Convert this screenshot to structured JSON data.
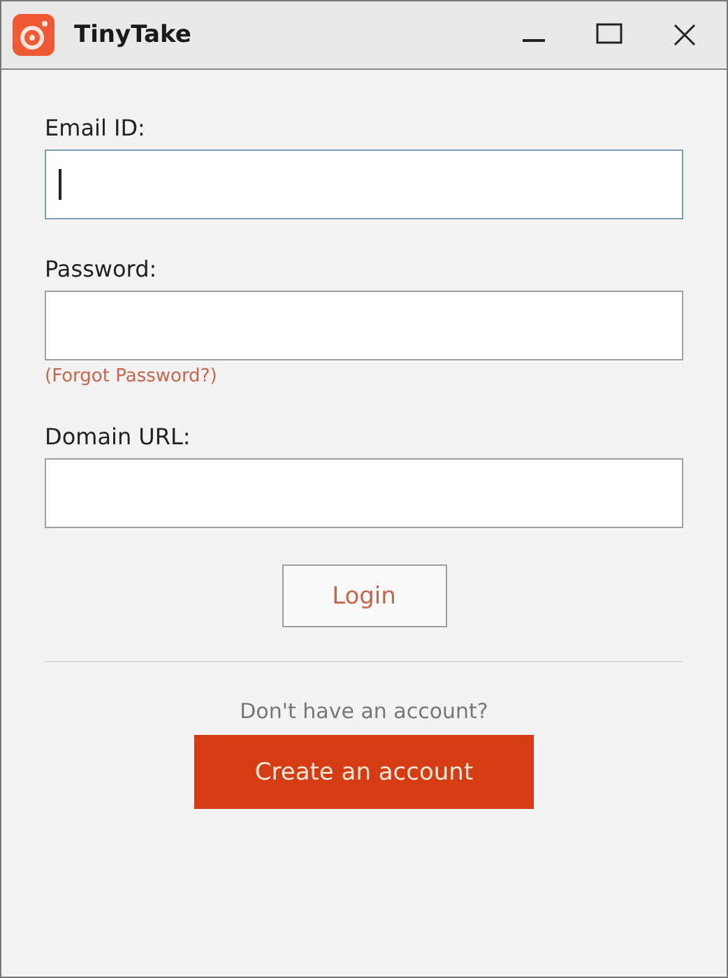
{
  "window": {
    "title": "TinyTake"
  },
  "fields": [
    {
      "label": "Email ID:",
      "focused": true
    },
    {
      "label": "Password:",
      "focused": false,
      "link": "(Forgot Password?)"
    },
    {
      "label": "Domain URL:",
      "focused": false
    }
  ],
  "login_button": "Login",
  "signup": {
    "prompt": "Don't have an account?",
    "button": "Create an account"
  }
}
